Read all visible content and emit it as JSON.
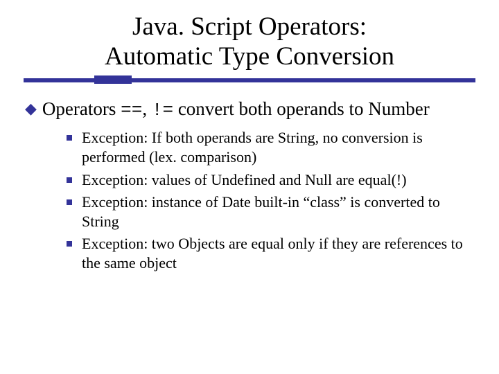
{
  "title": {
    "line1": "Java. Script Operators:",
    "line2": "Automatic Type Conversion"
  },
  "main_bullet": {
    "prefix": "Operators ",
    "code1": "==",
    "sep": ", ",
    "code2": "!=",
    "suffix": " convert both operands to Number"
  },
  "sub": [
    "Exception: If both operands are String, no conversion is performed (lex. comparison)",
    "Exception: values of Undefined and Null are equal(!)",
    "Exception: instance of Date built-in “class” is converted to String",
    "Exception: two Objects are equal only if they are references to the same object"
  ]
}
